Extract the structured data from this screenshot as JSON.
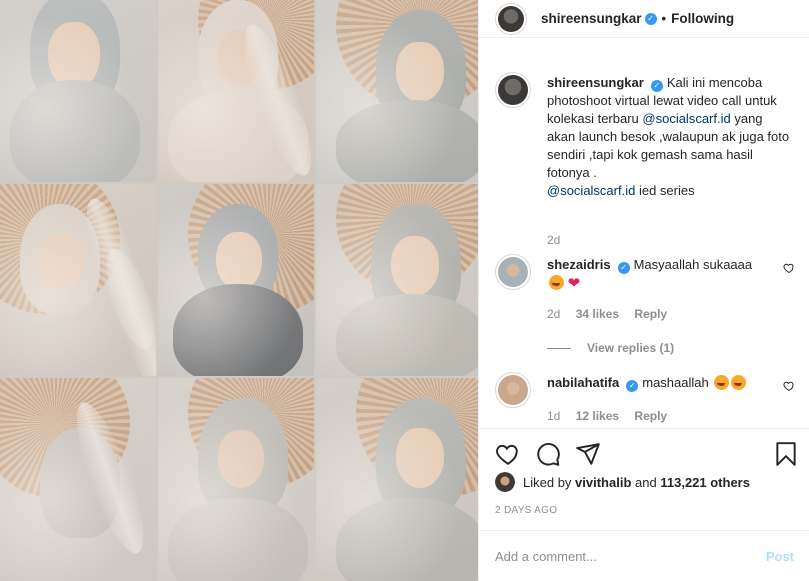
{
  "photo": {
    "alt_caption": ""
  },
  "header": {
    "username": "shireensungkar",
    "verified_badge": "verified-badge-icon",
    "separator": "•",
    "follow_status": "Following"
  },
  "caption": {
    "username": "shireensungkar",
    "text_part1": "Kali ini mencoba photoshoot virtual lewat video call untuk kolekasi terbaru ",
    "mention1": "@socialscarf.id",
    "text_part2": " yang akan launch besok ,walaupun ak juga foto sendiri ,tapi kok gemash sama hasil fotonya .",
    "mention2": "@socialscarf.id",
    "text_part3": " ied series",
    "age": "2d"
  },
  "comments": [
    {
      "username": "shezaidris",
      "text": "Masyaallah sukaaaa",
      "age": "2d",
      "likes": "34 likes",
      "reply": "Reply",
      "view_replies": "View replies (1)"
    },
    {
      "username": "nabilahatifa",
      "text": "mashaallah",
      "age": "1d",
      "likes": "12 likes",
      "reply": "Reply"
    }
  ],
  "likes": {
    "prefix": "Liked by",
    "user": "vivithalib",
    "conj": "and",
    "others": "113,221 others"
  },
  "timestamp": "2 DAYS AGO",
  "add_comment": {
    "placeholder": "Add a comment...",
    "post_label": "Post"
  },
  "colors": {
    "accent": "#3897f0",
    "mention": "#00376b",
    "secondary_text": "#8e8e8e",
    "post_disabled": "#b2dffc"
  },
  "icons": [
    "heart-icon",
    "comment-icon",
    "share-icon",
    "bookmark-icon",
    "verified-badge-icon",
    "small-heart-icon"
  ]
}
